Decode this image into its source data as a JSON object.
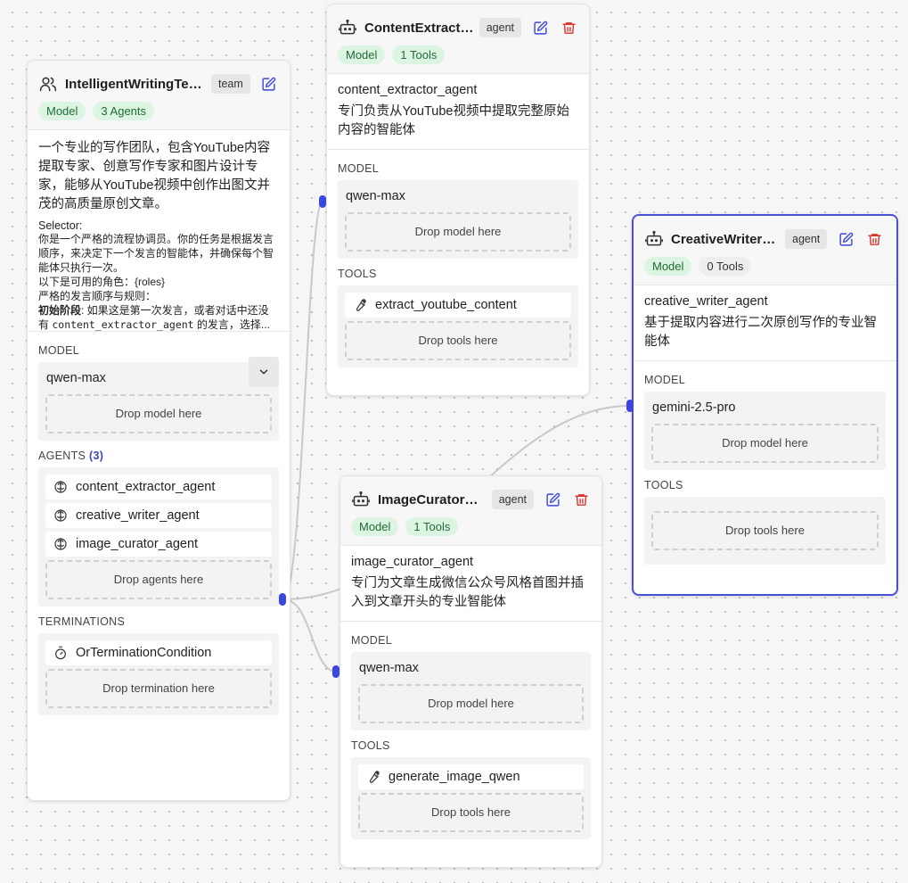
{
  "team": {
    "title": "IntelligentWritingTea...",
    "badge": "team",
    "pills": [
      "Model",
      "3 Agents"
    ],
    "description": "一个专业的写作团队，包含YouTube内容提取专家、创意写作专家和图片设计专家，能够从YouTube视频中创作出图文并茂的高质量原创文章。",
    "selector_label": "Selector:",
    "selector_lines": [
      "你是一个严格的流程协调员。你的任务是根据发言顺序，来决定下一个发言的智能体，并确保每个智能体只执行一次。",
      "以下是可用的角色：{roles}",
      "严格的发言顺序与规则："
    ],
    "selector_stage": "初始阶段",
    "selector_stage_text": ": 如果这是第一次发言，或者对话中还没有 ",
    "selector_code": "content_extractor_agent",
    "selector_tail": " 的发言，选择...",
    "model_label": "MODEL",
    "model_value": "qwen-max",
    "drop_model": "Drop model here",
    "agents_label": "AGENTS",
    "agents_count": "(3)",
    "agents": [
      "content_extractor_agent",
      "creative_writer_agent",
      "image_curator_agent"
    ],
    "drop_agents": "Drop agents here",
    "terminations_label": "TERMINATIONS",
    "termination": "OrTerminationCondition",
    "drop_termination": "Drop termination here"
  },
  "content_extractor": {
    "title": "ContentExtracto...",
    "badge": "agent",
    "pills": [
      "Model",
      "1 Tools"
    ],
    "name": "content_extractor_agent",
    "description": "专门负责从YouTube视频中提取完整原始内容的智能体",
    "model_label": "MODEL",
    "model_value": "qwen-max",
    "drop_model": "Drop model here",
    "tools_label": "TOOLS",
    "tool": "extract_youtube_content",
    "drop_tools": "Drop tools here"
  },
  "creative_writer": {
    "title": "CreativeWriterAg...",
    "badge": "agent",
    "pills": [
      "Model",
      "0 Tools"
    ],
    "name": "creative_writer_agent",
    "description": "基于提取内容进行二次原创写作的专业智能体",
    "model_label": "MODEL",
    "model_value": "gemini-2.5-pro",
    "drop_model": "Drop model here",
    "tools_label": "TOOLS",
    "drop_tools": "Drop tools here"
  },
  "image_curator": {
    "title": "ImageCuratorAg...",
    "badge": "agent",
    "pills": [
      "Model",
      "1 Tools"
    ],
    "name": "image_curator_agent",
    "description": "专门为文章生成微信公众号风格首图并插入到文章开头的专业智能体",
    "model_label": "MODEL",
    "model_value": "qwen-max",
    "drop_model": "Drop model here",
    "tools_label": "TOOLS",
    "tool": "generate_image_qwen",
    "drop_tools": "Drop tools here"
  },
  "colors": {
    "accent": "#3a46e0",
    "delete": "#d9342b",
    "pill_green_bg": "#dcf5e2",
    "edge": "#c9c9c9"
  },
  "icons": [
    "users-icon",
    "bot-icon",
    "edit-icon",
    "trash-icon",
    "brain-icon",
    "wrench-icon",
    "timer-icon",
    "chevron-down-icon"
  ]
}
